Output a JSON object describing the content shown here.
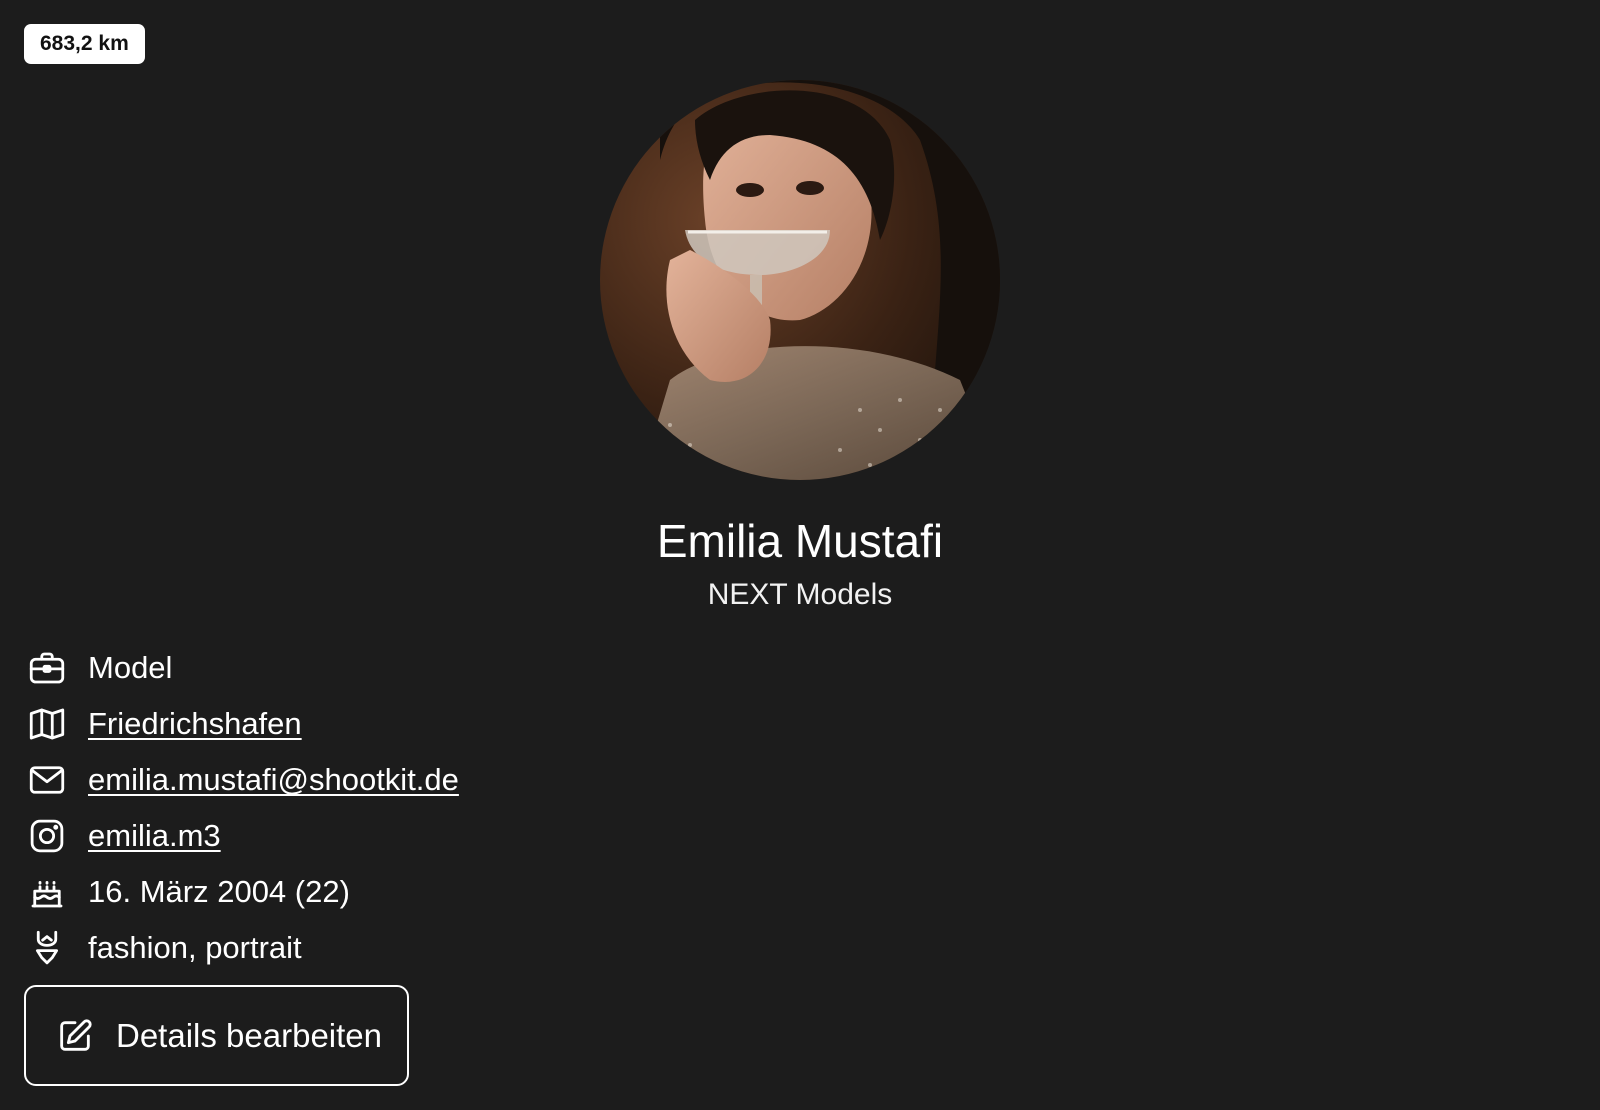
{
  "distance_badge": "683,2 km",
  "profile": {
    "name": "Emilia Mustafi",
    "agency": "NEXT Models"
  },
  "details": {
    "role": {
      "icon": "briefcase-icon",
      "text": "Model"
    },
    "location": {
      "icon": "map-icon",
      "text": "Friedrichshafen"
    },
    "email": {
      "icon": "mail-icon",
      "text": "emilia.mustafi@shootkit.de"
    },
    "instagram": {
      "icon": "instagram-icon",
      "text": "emilia.m3"
    },
    "birthday": {
      "icon": "cake-icon",
      "text": "16. März 2004 (22)"
    },
    "genres": {
      "icon": "swimsuit-icon",
      "text": "fashion, portrait"
    }
  },
  "edit_button": {
    "icon": "edit-icon",
    "label": "Details bearbeiten"
  },
  "colors": {
    "background": "#1c1c1c",
    "text": "#ffffff",
    "badge_bg": "#ffffff",
    "badge_text": "#111111"
  }
}
